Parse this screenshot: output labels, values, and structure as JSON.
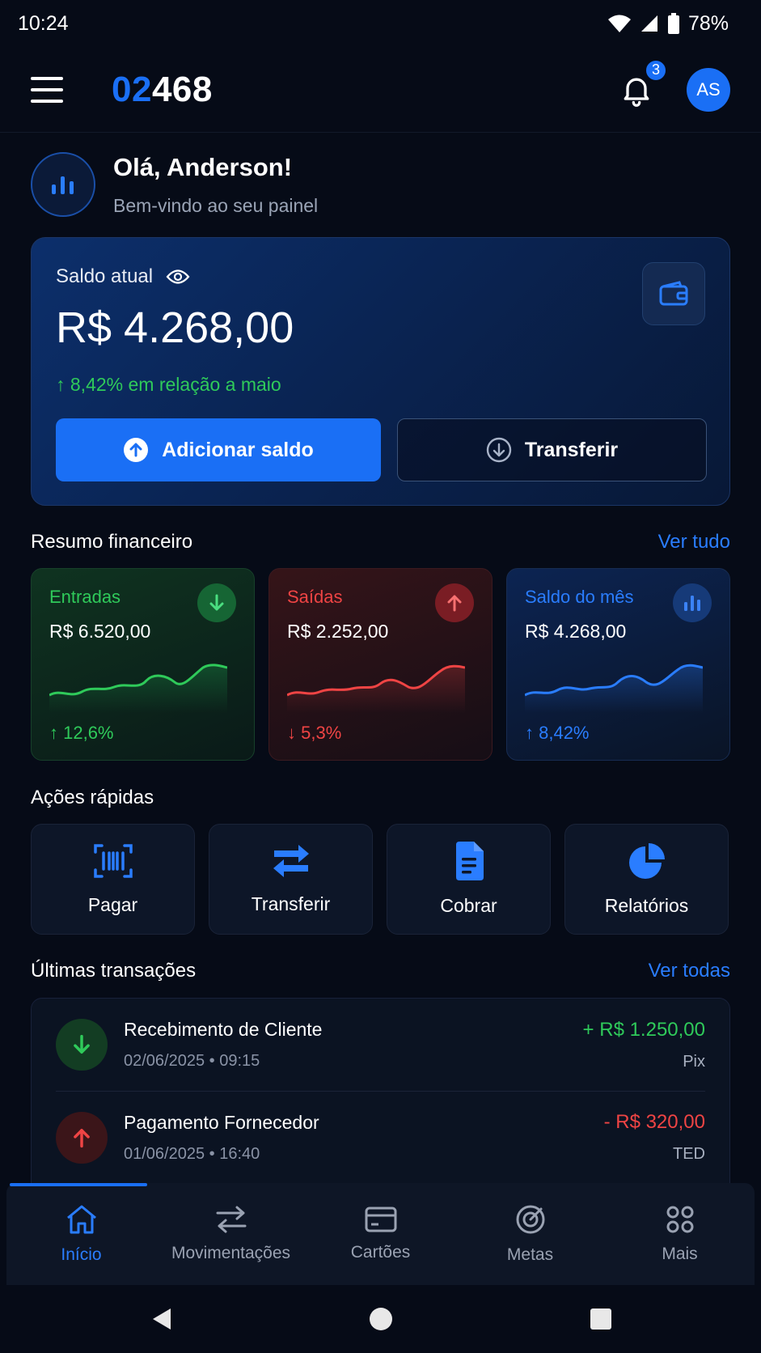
{
  "status_bar": {
    "time": "10:24",
    "battery": "78%"
  },
  "header": {
    "logo_accent": "02",
    "logo_rest": "468",
    "notification_count": "3",
    "avatar_initials": "AS"
  },
  "greeting": {
    "title": "Olá, Anderson!",
    "subtitle": "Bem-vindo ao seu painel"
  },
  "balance": {
    "label": "Saldo atual",
    "value": "R$ 4.268,00",
    "change": "↑ 8,42% em relação a maio",
    "add_label": "Adicionar saldo",
    "transfer_label": "Transferir"
  },
  "summary": {
    "heading": "Resumo financeiro",
    "link": "Ver tudo",
    "cards": [
      {
        "title": "Entradas",
        "value": "R$ 6.520,00",
        "change": "↑ 12,6%"
      },
      {
        "title": "Saídas",
        "value": "R$ 2.252,00",
        "change": "↓ 5,3%"
      },
      {
        "title": "Saldo do mês",
        "value": "R$ 4.268,00",
        "change": "↑ 8,42%"
      }
    ]
  },
  "quick_actions": {
    "heading": "Ações rápidas",
    "items": [
      {
        "label": "Pagar",
        "icon": "barcode-icon"
      },
      {
        "label": "Transferir",
        "icon": "transfer-arrows-icon"
      },
      {
        "label": "Cobrar",
        "icon": "document-icon"
      },
      {
        "label": "Relatórios",
        "icon": "pie-chart-icon"
      }
    ]
  },
  "transactions": {
    "heading": "Últimas transações",
    "link": "Ver todas",
    "items": [
      {
        "title": "Recebimento de Cliente",
        "date": "02/06/2025 • 09:15",
        "amount": "+ R$ 1.250,00",
        "method": "Pix"
      },
      {
        "title": "Pagamento Fornecedor",
        "date": "01/06/2025 • 16:40",
        "amount": "- R$ 320,00",
        "method": "TED"
      }
    ]
  },
  "bottom_nav": {
    "items": [
      {
        "label": "Início",
        "icon": "home-icon"
      },
      {
        "label": "Movimentações",
        "icon": "transfer-icon"
      },
      {
        "label": "Cartões",
        "icon": "card-icon"
      },
      {
        "label": "Metas",
        "icon": "target-icon"
      },
      {
        "label": "Mais",
        "icon": "grid-icon"
      }
    ]
  },
  "colors": {
    "accent": "#1a6ff5",
    "positive": "#2fca5a",
    "negative": "#ef4444",
    "background": "#060b17"
  }
}
